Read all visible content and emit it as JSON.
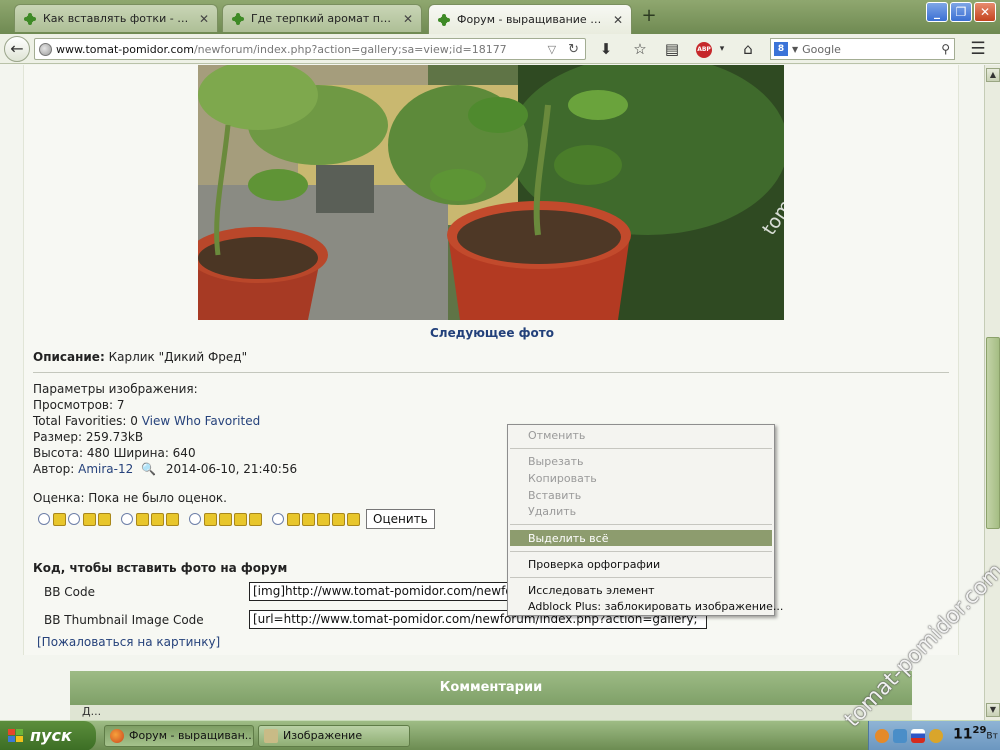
{
  "browser": {
    "tabs": [
      {
        "title": "Как вставлять фотки - част...",
        "active": false
      },
      {
        "title": "Где терпкий аромат полын...",
        "active": false
      },
      {
        "title": "Форум - выращивание тома...",
        "active": true
      }
    ],
    "new_tab_label": "+",
    "url_domain": "www.tomat-pomidor.com",
    "url_path": "/newforum/index.php?action=gallery;sa=view;id=18177",
    "search_placeholder": "Google",
    "search_engine_icon": "google-icon",
    "abp_badge": "ABP"
  },
  "photo": {
    "watermark": "tomat-pomidor.com"
  },
  "page": {
    "next_photo": "Следующее фото",
    "description_label": "Описание:",
    "description_value": "Карлик \"Дикий Фред\"",
    "params": {
      "header": "Параметры изображения:",
      "views": "Просмотров: 7",
      "favorites_label": "Total Favorities: 0",
      "favorites_link": "View Who Favorited",
      "size": "Размер: 259.73kB",
      "dimensions": "Высота: 480 Ширина: 640",
      "author_label": "Автор:",
      "author_name": "Amira-12",
      "date": "2014-06-10, 21:40:56"
    },
    "rating_label": "Оценка: Пока не было оценок.",
    "rating_stars": [
      1,
      2,
      3,
      4,
      5
    ],
    "rate_button": "Оценить",
    "code_title": "Код, чтобы вставить фото на форум",
    "bb_code_label": "BB Code",
    "bb_code_value": "[img]http://www.tomat-pomidor.com/newforum/index.php?action=gallery;sa=view;id=18177",
    "bb_thumb_label": "BB Thumbnail Image Code",
    "bb_thumb_value": "[url=http://www.tomat-pomidor.com/newforum/index.php?action=gallery;",
    "report_link": "[Пожаловаться на картинку]",
    "comments_header": "Комментарии",
    "comments_sub": "Д..."
  },
  "context_menu": {
    "undo": "Отменить",
    "cut": "Вырезать",
    "copy": "Копировать",
    "paste": "Вставить",
    "delete": "Удалить",
    "select_all": "Выделить всё",
    "spellcheck": "Проверка орфографии",
    "inspect": "Исследовать элемент",
    "adblock": "Adblock Plus: заблокировать изображение..."
  },
  "page_watermark": "tomat-pomidor.com",
  "taskbar": {
    "start_label": "пуск",
    "tasks": [
      {
        "label": "Форум - выращиван...",
        "active": true
      },
      {
        "label": "Изображение",
        "active": false
      }
    ],
    "clock_time": "11",
    "clock_minutes": "29",
    "clock_day": "Вт"
  },
  "colors": {
    "accent_green": "#8d9c6e",
    "link_blue": "#26427b",
    "star_yellow": "#e8c62b"
  }
}
